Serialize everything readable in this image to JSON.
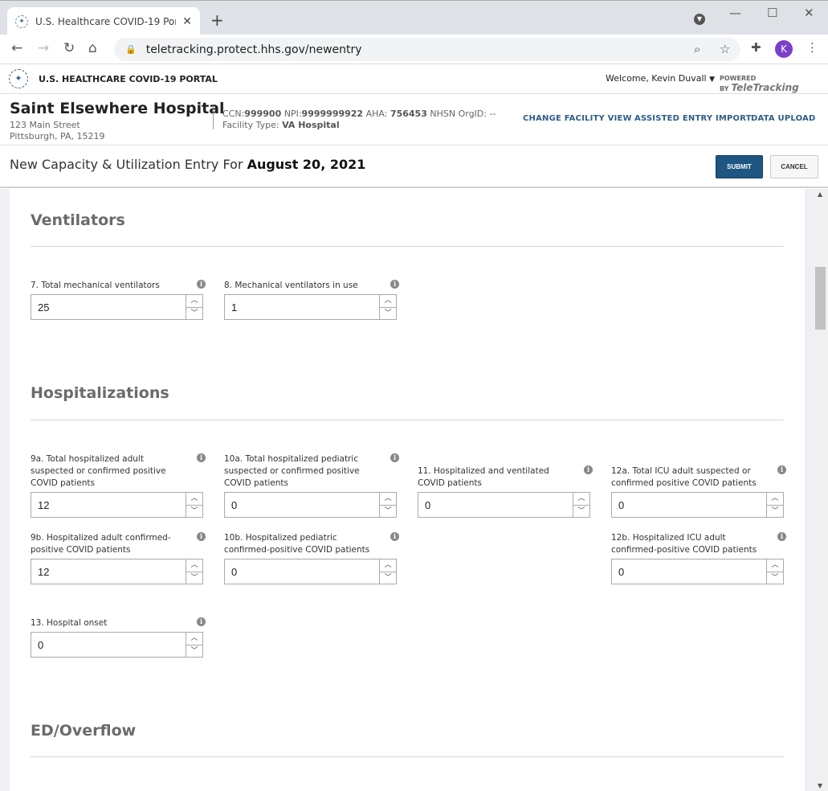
{
  "browser": {
    "tab_title": "U.S. Healthcare COVID-19 Portal",
    "url": "teletracking.protect.hhs.gov/newentry",
    "profile_initial": "K"
  },
  "app": {
    "title": "U.S. HEALTHCARE COVID-19 PORTAL",
    "welcome": "Welcome, Kevin Duvall",
    "powered_by": "POWERED BY",
    "brand": "TeleTracking"
  },
  "facility": {
    "name": "Saint Elsewhere Hospital",
    "address1": "123 Main Street",
    "address2": "Pittsburgh, PA, 15219",
    "ccn_label": "CCN:",
    "ccn": "999900",
    "npi_label": "NPI:",
    "npi": "9999999922",
    "aha_label": "AHA:",
    "aha": "756453",
    "nhsn": "NHSN OrgID: --",
    "type_label": "Facility Type:",
    "type": "VA Hospital",
    "links": [
      "CHANGE FACILITY VIEW",
      "ASSISTED ENTRY IMPORT",
      "DATA UPLOAD"
    ]
  },
  "entry": {
    "title": "New Capacity & Utilization Entry For",
    "date": "August 20, 2021",
    "submit": "SUBMIT",
    "cancel": "CANCEL"
  },
  "sections": {
    "ventilators": "Ventilators",
    "hospitalizations": "Hospitalizations",
    "ed": "ED/Overflow"
  },
  "fields": [
    {
      "label": "7. Total mechanical ventilators",
      "value": "25"
    },
    {
      "label": "8. Mechanical ventilators in use",
      "value": "1"
    },
    {
      "label": "9a. Total hospitalized adult suspected or confirmed positive COVID patients",
      "value": "12"
    },
    {
      "label": "10a. Total hospitalized pediatric suspected or confirmed positive COVID patients",
      "value": "0"
    },
    {
      "label": "11. Hospitalized and ventilated COVID patients",
      "value": "0"
    },
    {
      "label": "12a. Total ICU adult suspected or confirmed positive COVID patients",
      "value": "0"
    },
    {
      "label": "9b. Hospitalized adult confirmed-positive COVID patients",
      "value": "12"
    },
    {
      "label": "10b. Hospitalized pediatric confirmed-positive COVID patients",
      "value": "0"
    },
    {
      "label": "12b. Hospitalized ICU adult confirmed-positive COVID patients",
      "value": "0"
    },
    {
      "label": "13. Hospital onset",
      "value": "0"
    }
  ]
}
